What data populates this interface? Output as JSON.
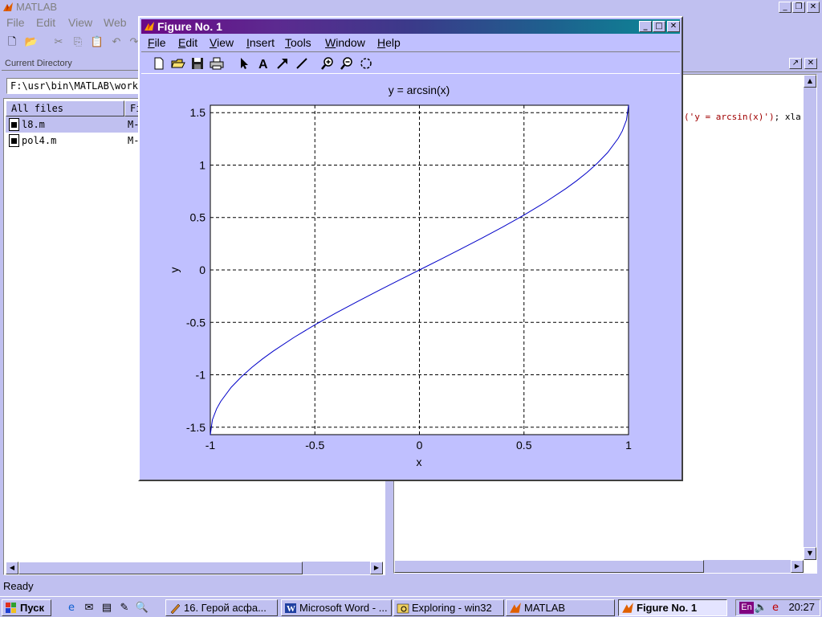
{
  "matlab": {
    "title": "MATLAB",
    "menu": [
      "File",
      "Edit",
      "View",
      "Web"
    ],
    "window_buttons": [
      "_",
      "❐",
      "✕"
    ]
  },
  "current_directory": {
    "header": "Current Directory",
    "path": "F:\\usr\\bin\\MATLAB\\work",
    "columns": [
      "All files",
      "Fi"
    ],
    "files": [
      {
        "name": "l8.m",
        "type": "M-"
      },
      {
        "name": "pol4.m",
        "type": "M-"
      }
    ]
  },
  "command": {
    "visible_code_red": "('y = arcsin(x)')",
    "visible_code_tail": "; xla"
  },
  "status": "Ready",
  "figure": {
    "title": "Figure No. 1",
    "menu": [
      "File",
      "Edit",
      "View",
      "Insert",
      "Tools",
      "Window",
      "Help"
    ],
    "menu_underline": [
      "F",
      "E",
      "V",
      "I",
      "T",
      "W",
      "H"
    ],
    "toolbar_icons": [
      "new-icon",
      "open-icon",
      "save-icon",
      "print-icon",
      "arrow-select-icon",
      "text-insert-icon",
      "arrow-insert-icon",
      "line-insert-icon",
      "zoom-in-icon",
      "zoom-out-icon",
      "rotate-icon"
    ],
    "colors": {
      "plot_line": "#0000c8",
      "axes_bg": "#ffffff",
      "figure_bg": "#c0c0ff"
    }
  },
  "chart_data": {
    "type": "line",
    "title": "y = arcsin(x)",
    "xlabel": "x",
    "ylabel": "y",
    "xlim": [
      -1,
      1
    ],
    "ylim": [
      -1.5708,
      1.5708
    ],
    "xticks": [
      -1,
      -0.5,
      0,
      0.5,
      1
    ],
    "xticklabels": [
      "-1",
      "-0.5",
      "0",
      "0.5",
      "1"
    ],
    "yticks": [
      -1.5,
      -1,
      -0.5,
      0,
      0.5,
      1,
      1.5
    ],
    "yticklabels": [
      "-1.5",
      "-1",
      "-0.5",
      "0",
      "0.5",
      "1",
      "1.5"
    ],
    "grid": true,
    "series": [
      {
        "x": [
          -1,
          -0.99,
          -0.97,
          -0.95,
          -0.9,
          -0.85,
          -0.8,
          -0.75,
          -0.7,
          -0.6,
          -0.5,
          -0.4,
          -0.3,
          -0.2,
          -0.1,
          0,
          0.1,
          0.2,
          0.3,
          0.4,
          0.5,
          0.6,
          0.7,
          0.75,
          0.8,
          0.85,
          0.9,
          0.95,
          0.97,
          0.99,
          1
        ],
        "y": [
          -1.5708,
          -1.4293,
          -1.3252,
          -1.2532,
          -1.1198,
          -1.016,
          -0.9273,
          -0.8481,
          -0.7754,
          -0.6435,
          -0.5236,
          -0.4115,
          -0.3047,
          -0.2014,
          -0.1002,
          0,
          0.1002,
          0.2014,
          0.3047,
          0.4115,
          0.5236,
          0.6435,
          0.7754,
          0.8481,
          0.9273,
          1.016,
          1.1198,
          1.2532,
          1.3252,
          1.4293,
          1.5708
        ]
      }
    ]
  },
  "taskbar": {
    "start": "Пуск",
    "tasks": [
      {
        "label": "16. Герой асфа..."
      },
      {
        "label": "Microsoft Word - ..."
      },
      {
        "label": "Exploring - win32"
      },
      {
        "label": "MATLAB"
      },
      {
        "label": "Figure No. 1"
      }
    ],
    "lang": "En",
    "clock": "20:27"
  }
}
